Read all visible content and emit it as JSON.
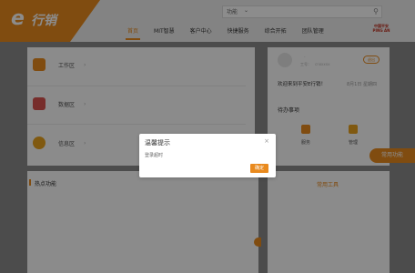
{
  "header": {
    "logo_e": "e",
    "logo_text": "行销",
    "search": {
      "label": "功能",
      "placeholder": ""
    },
    "nav": [
      "首页",
      "MIT智慧",
      "客户中心",
      "快捷服务",
      "综合开拓",
      "团队管理"
    ],
    "active_nav_index": 0,
    "brand": "中国平安\nPING AN"
  },
  "zones": [
    {
      "label": "工作区",
      "color": "#e98a1e"
    },
    {
      "label": "数据区",
      "color": "#d9534f"
    },
    {
      "label": "信息区",
      "color": "#e9a31e"
    }
  ],
  "user": {
    "tag": "-",
    "id": "工号：",
    "role": "cnoxxxx",
    "logout_label": "退出",
    "welcome": "欢迎来到平安E行销！",
    "date": "8月1日",
    "weekday": "星期四"
  },
  "todo": {
    "title": "待办事项",
    "items": [
      {
        "label": "服务",
        "color": "#e98a1e"
      },
      {
        "label": "管理",
        "color": "#e9a31e"
      }
    ]
  },
  "side_button": "常用功能",
  "hot_title": "热点功能",
  "tools_title": "常用工具",
  "modal": {
    "title": "温馨提示",
    "close": "×",
    "message": "登录超时",
    "ok_label": "确定"
  },
  "colors": {
    "accent": "#e98a1e"
  }
}
